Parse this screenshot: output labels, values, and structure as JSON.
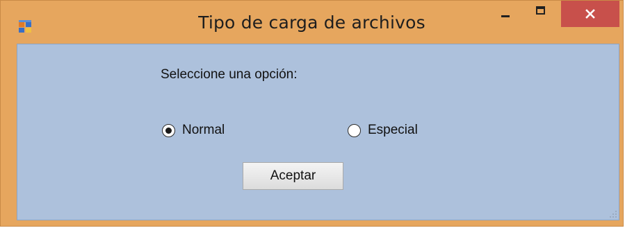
{
  "window": {
    "title": "Tipo de carga de archivos",
    "icon": "app-window-icon",
    "controls": {
      "minimize": "minimize-icon",
      "maximize": "maximize-icon",
      "close": "close-icon"
    },
    "colors": {
      "frame": "#e6a65e",
      "close_button": "#c8504b",
      "client_background": "#adc1dc"
    }
  },
  "form": {
    "prompt": "Seleccione una opción:",
    "options": [
      {
        "label": "Normal",
        "selected": true
      },
      {
        "label": "Especial",
        "selected": false
      }
    ],
    "accept_label": "Aceptar"
  }
}
